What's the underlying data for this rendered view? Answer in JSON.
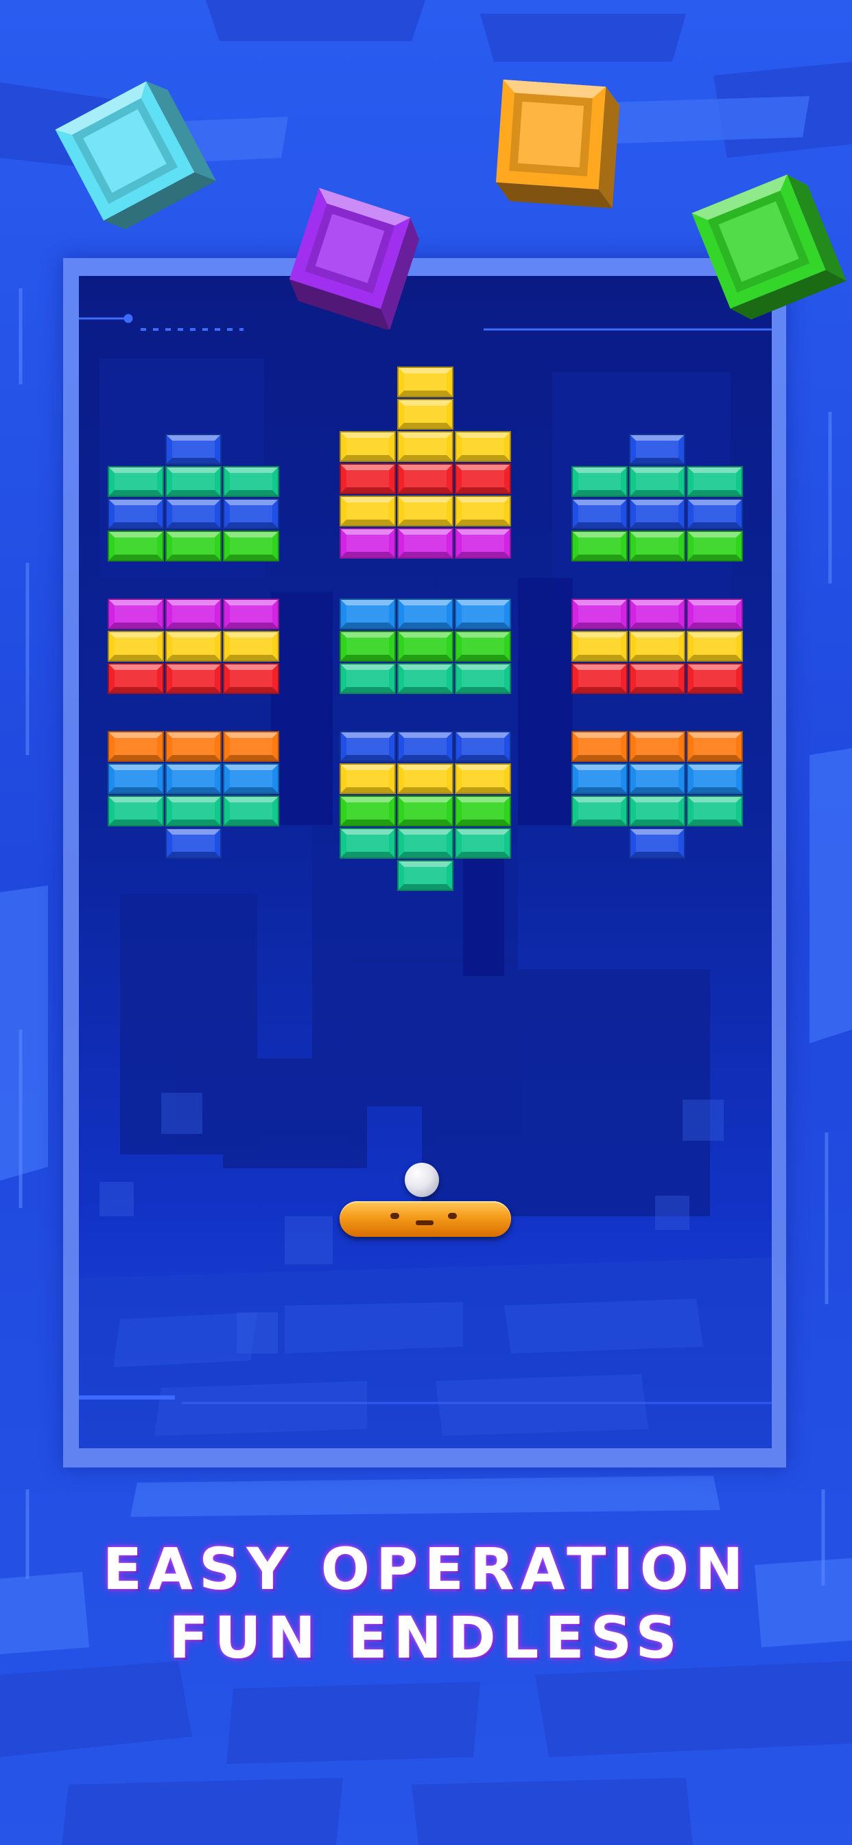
{
  "headline": {
    "line1": "EASY OPERATION",
    "line2": "FUN ENDLESS"
  },
  "colors": {
    "background": "#1f4fe0",
    "board": "#0b2399",
    "frame": "#96afff",
    "paddle": "#f59b1a",
    "ball": "#e6e6ee",
    "headline_glow": "#8a2be2"
  },
  "brick_colors": {
    "Y": "#ffd21a",
    "R": "#f2212a",
    "M": "#d324e6",
    "B": "#1f4fe6",
    "T": "#12c98c",
    "G": "#2fd41c",
    "O": "#ff7a10",
    "A": "#1c8cf0"
  },
  "decor_cubes": [
    {
      "name": "cyan-cube",
      "color": "#5fe0f5"
    },
    {
      "name": "purple-cube",
      "color": "#a12ff0"
    },
    {
      "name": "orange-cube",
      "color": "#ffa820"
    },
    {
      "name": "green-cube",
      "color": "#35d62a"
    }
  ],
  "brick_formations": [
    {
      "name": "formation-top-left",
      "rows": [
        ".B.",
        "TTT",
        "BBB",
        "GGG"
      ]
    },
    {
      "name": "formation-top-center",
      "rows": [
        ".Y.",
        ".Y.",
        "YYY",
        "RRR",
        "YYY",
        "MMM"
      ]
    },
    {
      "name": "formation-top-right",
      "rows": [
        ".B.",
        "TTT",
        "BBB",
        "GGG"
      ]
    },
    {
      "name": "formation-mid-left",
      "rows": [
        "MMM",
        "YYY",
        "RRR"
      ]
    },
    {
      "name": "formation-mid-center",
      "rows": [
        "AAA",
        "GGG",
        "TTT"
      ]
    },
    {
      "name": "formation-mid-right",
      "rows": [
        "MMM",
        "YYY",
        "RRR"
      ]
    },
    {
      "name": "formation-bottom-left",
      "rows": [
        "OOO",
        "AAA",
        "TTT",
        ".B."
      ]
    },
    {
      "name": "formation-bottom-center",
      "rows": [
        "BBB",
        "YYY",
        "GGG",
        "TTT",
        ".T."
      ]
    },
    {
      "name": "formation-bottom-right",
      "rows": [
        "OOO",
        "AAA",
        "TTT",
        ".B."
      ]
    }
  ]
}
